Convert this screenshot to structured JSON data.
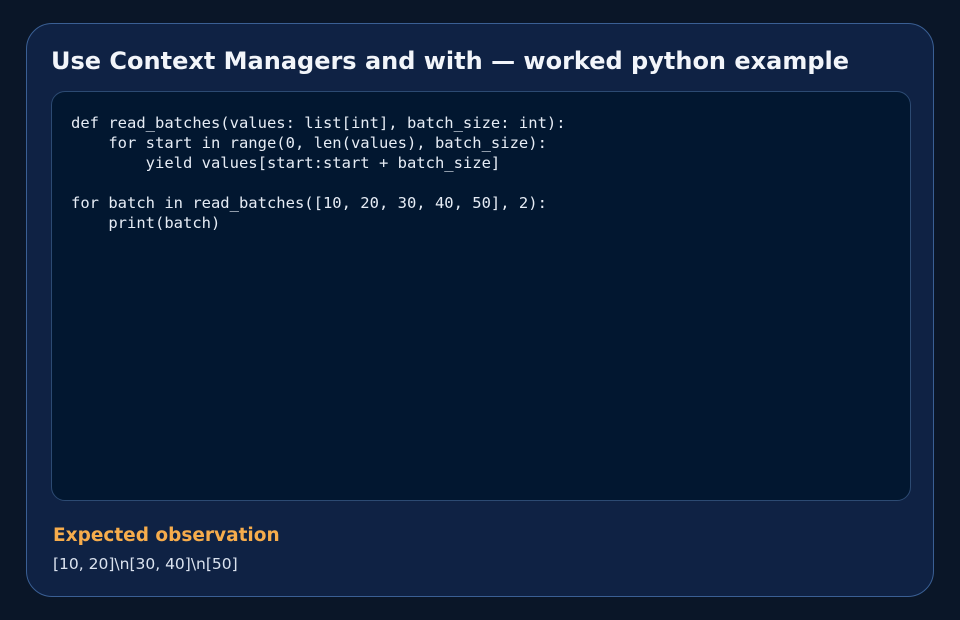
{
  "card": {
    "title": "Use Context Managers and with — worked python example",
    "code": "def read_batches(values: list[int], batch_size: int):\n    for start in range(0, len(values), batch_size):\n        yield values[start:start + batch_size]\n\nfor batch in read_batches([10, 20, 30, 40, 50], 2):\n    print(batch)",
    "observation": {
      "label": "Expected observation",
      "value": "[10, 20]\\n[30, 40]\\n[50]"
    }
  }
}
